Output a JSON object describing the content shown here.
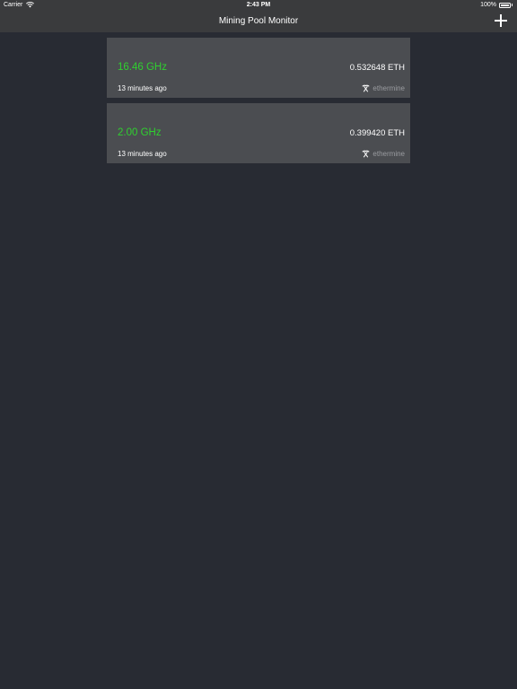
{
  "status_bar": {
    "carrier": "Carrier",
    "time": "2:43 PM",
    "battery_label": "100%",
    "battery_level": 1.0
  },
  "nav": {
    "title": "Mining Pool Monitor",
    "add_icon": "plus-icon"
  },
  "pools": [
    {
      "hashrate": "16.46 GHz",
      "balance": "0.532648 ETH",
      "updated": "13 minutes ago",
      "pool_name": "ethermine",
      "pool_icon": "pickaxe-icon"
    },
    {
      "hashrate": "2.00 GHz",
      "balance": "0.399420 ETH",
      "updated": "13 minutes ago",
      "pool_name": "ethermine",
      "pool_icon": "pickaxe-icon"
    }
  ],
  "colors": {
    "background": "#282b33",
    "bar": "#3a3b3d",
    "card": "#4b4d51",
    "hashrate": "#2fd02f",
    "muted": "#9a9ca0"
  }
}
